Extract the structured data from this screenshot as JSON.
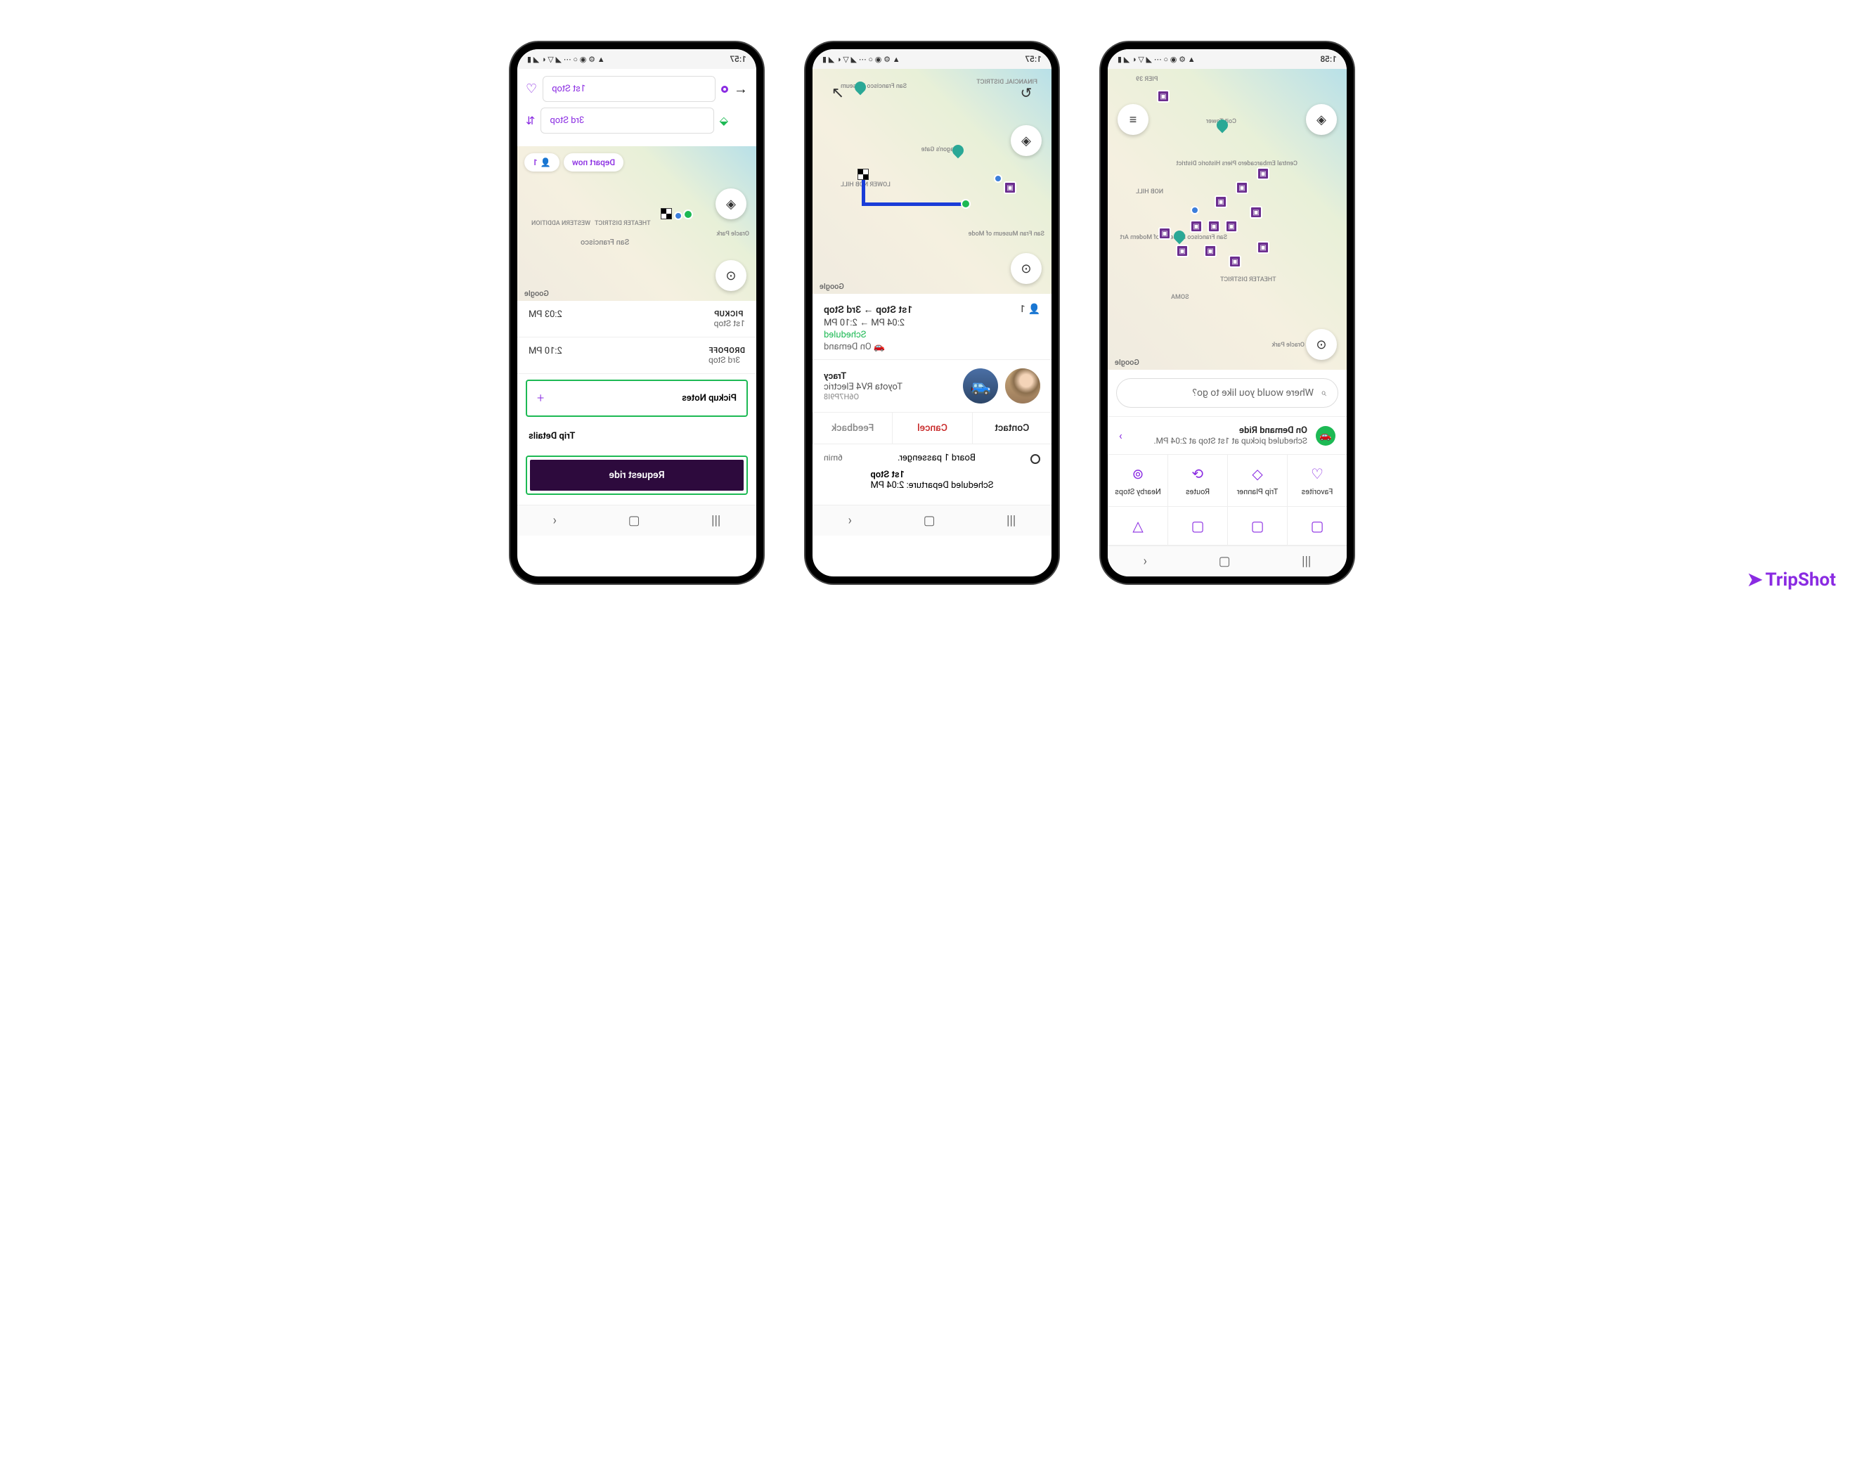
{
  "status_bar": {
    "time": "1:57",
    "icons": "▲ ⚙ ◉ ○ ⋯     ◢ ▽ ◐ ◢ ▮"
  },
  "status_bar_2": {
    "time": "1:57"
  },
  "status_bar_3": {
    "time": "1:58"
  },
  "phone1": {
    "search_placeholder": "Where would you like to go?",
    "ride_title": "On Demand Ride",
    "ride_sub": "Scheduled pickup at 1st Stop at 2:04 PM.",
    "nav": [
      "Favorites",
      "Trip Planner",
      "Routes",
      "Nearby Stops"
    ],
    "map_labels": [
      "PIER 39",
      "Coit Tower",
      "NOB HILL",
      "Central Embarcadero Piers Historic District",
      "SOMA",
      "THEATER DISTRICT",
      "Oracle Park",
      "San Francisco Museum of Modern Art"
    ],
    "google": "Google"
  },
  "phone2": {
    "trip_title": "1st Stop → 3rd Stop",
    "trip_time": "2:04 PM → 2:10 PM",
    "trip_status": "Scheduled",
    "trip_type": "🚗 On Demand",
    "passenger_count": "1",
    "driver_name": "Tracy",
    "driver_car": "Toyota RV4 Electric",
    "driver_plate": "O6H7P9I8",
    "actions": {
      "contact": "Contact",
      "cancel": "Cancel",
      "feedback": "Feedback"
    },
    "board_text": "Board 1 passenger.",
    "eta": "6min",
    "stop1": "1st Stop",
    "departure": "Scheduled Departure: 2:04 PM",
    "map_labels": [
      "FINANCIAL DISTRICT",
      "Dragon's Gate",
      "LOWER NOB HILL",
      "San Francisco Museum",
      "San Fran Museum of Mode"
    ],
    "google": "Google"
  },
  "phone3": {
    "stop1": "1st Stop",
    "stop3": "3rd Stop",
    "depart_chip": "Depart now",
    "pax_chip": "1",
    "pickup_label": "PICKUP",
    "pickup_loc": "1st Stop",
    "pickup_time": "2:03 PM",
    "dropoff_label": "DROPOFF",
    "dropoff_loc": "3rd Stop",
    "dropoff_time": "2:10 PM",
    "notes_label": "Pickup Notes",
    "details_label": "Trip Details",
    "request_label": "Request ride",
    "map_labels": [
      "San Francisco",
      "Oracle Park",
      "WESTERN ADDITION",
      "THEATER DISTRICT"
    ],
    "google": "Google"
  },
  "brand": "TripShot"
}
